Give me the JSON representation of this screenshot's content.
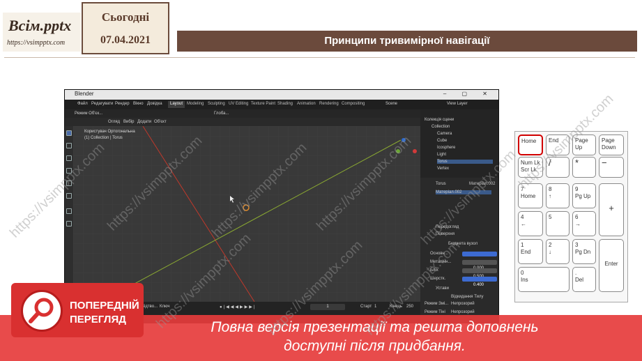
{
  "header": {
    "logo_title": "Всім.pptx",
    "logo_url": "https://vsimpptx.com",
    "day_label": "Сьогодні",
    "date": "07.04.2021",
    "slide_title": "Принципи тривимірної навігації"
  },
  "watermark": "https://vsimpptx.com",
  "blender": {
    "window_title": "Blender",
    "menu": [
      "Файл",
      "Редагувати",
      "Рендер",
      "Вікно",
      "Довідка"
    ],
    "workspace_tabs": [
      "Layout",
      "Modeling",
      "Sculpting",
      "UV Editing",
      "Texture Paint",
      "Shading",
      "Animation",
      "Rendering",
      "Compositing"
    ],
    "active_tab": "Layout",
    "scene": "Scene",
    "view_layer": "View Layer",
    "mode": "Режим Об'єк...",
    "header_menus": [
      "Огляд",
      "Вибір",
      "Додати",
      "Об'єкт"
    ],
    "transform": "Глоба...",
    "viewport_info_line1": "Користувач Ортогональна",
    "viewport_info_line2": "(1) Collection | Torus",
    "outliner": {
      "title": "Колекція сцени",
      "items": [
        "Collection",
        "Camera",
        "Cube",
        "Icosphere",
        "Light",
        "Torus",
        "Vertex"
      ]
    },
    "properties": {
      "object": "Torus",
      "material": "Матеріал.002",
      "material_slot": "Матеріал.002",
      "preview": "Передогляд",
      "surface": "Поверхня",
      "shader": "Бюджета вузол",
      "rows": [
        {
          "label": "Основн...",
          "value": ""
        },
        {
          "label": "Металічн...",
          "value": "0.000"
        },
        {
          "label": "Бліх",
          "value": "0.500"
        },
        {
          "label": "Шерстк.",
          "value": "0.400"
        }
      ],
      "settings": "Устави",
      "backface": "Відкидання Тилу",
      "blend_mode_label": "Режим Змі...",
      "blend_mode": "Непрозорий",
      "shadow_label": "Режим Тіні",
      "shadow": "Непрозорий"
    },
    "timeline": {
      "playback": "Відтво...",
      "keying": "Ключ",
      "current_frame": "1",
      "start_label": "Старт",
      "start": "1",
      "end_label": "Кінець",
      "end": "250"
    }
  },
  "keypad": {
    "keys": [
      {
        "id": "home",
        "line1": "Home",
        "line2": ""
      },
      {
        "id": "end",
        "line1": "End",
        "line2": ""
      },
      {
        "id": "pgup",
        "line1": "Page",
        "line2": "Up"
      },
      {
        "id": "pgdn",
        "line1": "Page",
        "line2": "Down"
      },
      {
        "id": "numlk",
        "line1": "Num Lk",
        "line2": "Scr Lk"
      },
      {
        "id": "div",
        "line1": "/",
        "line2": ""
      },
      {
        "id": "mul",
        "line1": "*",
        "line2": ""
      },
      {
        "id": "minus",
        "line1": "−",
        "line2": ""
      },
      {
        "id": "k7",
        "line1": "7",
        "line2": "Home"
      },
      {
        "id": "k8",
        "line1": "8",
        "line2": "↑"
      },
      {
        "id": "k9",
        "line1": "9",
        "line2": "Pg Up"
      },
      {
        "id": "plus",
        "line1": "+",
        "line2": ""
      },
      {
        "id": "k4",
        "line1": "4",
        "line2": "←"
      },
      {
        "id": "k5",
        "line1": "5",
        "line2": ""
      },
      {
        "id": "k6",
        "line1": "6",
        "line2": "→"
      },
      {
        "id": "k1",
        "line1": "1",
        "line2": "End"
      },
      {
        "id": "k2",
        "line1": "2",
        "line2": "↓"
      },
      {
        "id": "k3",
        "line1": "3",
        "line2": "Pg Dn"
      },
      {
        "id": "enter",
        "line1": "Enter",
        "line2": ""
      },
      {
        "id": "k0",
        "line1": "0",
        "line2": "Ins"
      },
      {
        "id": "dot",
        "line1": ".",
        "line2": "Del"
      }
    ],
    "highlighted": "home"
  },
  "preview": {
    "line1": "ПОПЕРЕДНІЙ",
    "line2": "ПЕРЕГЛЯД"
  },
  "banner": {
    "line1": "Повна версія презентації та решта доповнень",
    "line2": "доступні після придбання."
  },
  "colors": {
    "title_bar": "#6b4a3c",
    "banner": "#e63c3c",
    "highlight": "#d10000"
  }
}
